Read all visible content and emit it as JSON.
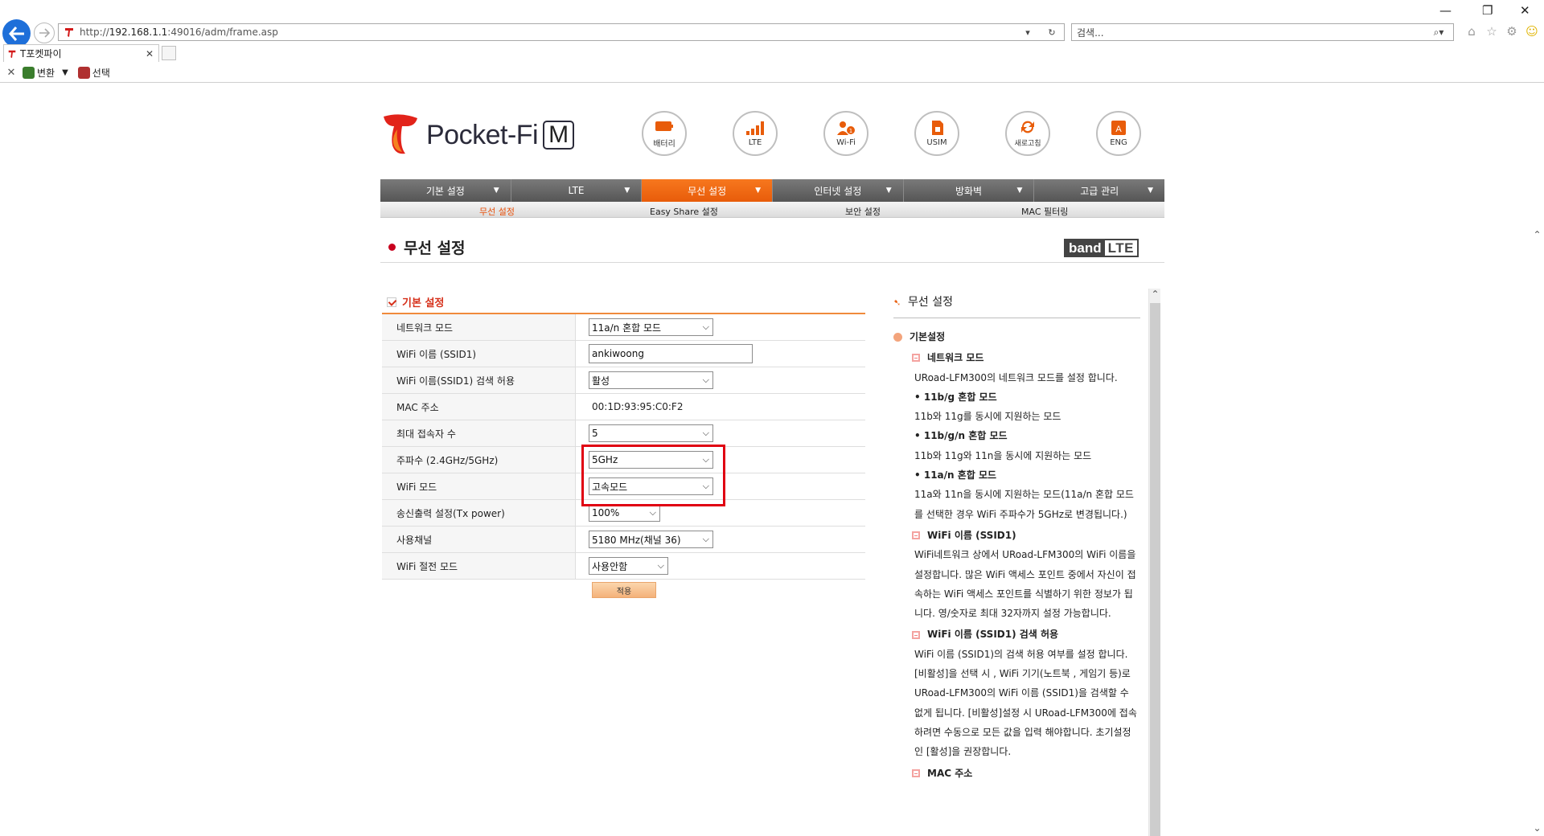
{
  "browser": {
    "url_prefix": "http://",
    "url_host": "192.168.1.1",
    "url_rest": ":49016/adm/frame.asp",
    "search_placeholder": "검색...",
    "tab_title": "T포켓파이",
    "fav_items": [
      "변환",
      "선택"
    ]
  },
  "logo": {
    "text": "Pocket-Fi",
    "badge": "M"
  },
  "top_icons": [
    "배터리",
    "LTE",
    "Wi-Fi",
    "USIM",
    "새로고침",
    "ENG"
  ],
  "main_nav": [
    {
      "label": "기본 설정",
      "active": false
    },
    {
      "label": "LTE",
      "active": false
    },
    {
      "label": "무선 설정",
      "active": true
    },
    {
      "label": "인터넷 설정",
      "active": false
    },
    {
      "label": "방화벽",
      "active": false
    },
    {
      "label": "고급 관리",
      "active": false
    }
  ],
  "sub_nav": [
    {
      "label": "무선 설정",
      "active": true
    },
    {
      "label": "Easy Share 설정",
      "active": false
    },
    {
      "label": "보안 설정",
      "active": false
    },
    {
      "label": "MAC 필터링",
      "active": false
    }
  ],
  "page_title": "무선 설정",
  "band_logo": {
    "left": "band",
    "right": "LTE"
  },
  "form": {
    "section_title": "기본 설정",
    "rows": [
      {
        "label": "네트워크 모드",
        "type": "select",
        "value": "11a/n 혼합 모드"
      },
      {
        "label": "WiFi 이름 (SSID1)",
        "type": "text",
        "value": "ankiwoong"
      },
      {
        "label": "WiFi 이름(SSID1) 검색 허용",
        "type": "select",
        "value": "활성"
      },
      {
        "label": "MAC 주소",
        "type": "static",
        "value": "00:1D:93:95:C0:F2"
      },
      {
        "label": "최대 접속자 수",
        "type": "select",
        "value": "5"
      },
      {
        "label": "주파수 (2.4GHz/5GHz)",
        "type": "select",
        "value": "5GHz"
      },
      {
        "label": "WiFi 모드",
        "type": "select",
        "value": "고속모드"
      },
      {
        "label": "송신출력 설정(Tx power)",
        "type": "select",
        "value": "100%"
      },
      {
        "label": "사용채널",
        "type": "select",
        "value": "5180 MHz(채널 36)"
      },
      {
        "label": "WiFi 절전 모드",
        "type": "select",
        "value": "사용안함"
      }
    ],
    "apply_label": "적용"
  },
  "help": {
    "title": "무선 설정",
    "section": "기본설정",
    "sub1": "네트워크 모드",
    "p1": "URoad-LFM300의 네트워크 모드를 설정 합니다.",
    "b1": "• 11b/g 혼합 모드",
    "p2": "11b와 11g를 동시에 지원하는 모드",
    "b2": "• 11b/g/n 혼합 모드",
    "p3": "11b와 11g와 11n을 동시에 지원하는 모드",
    "b3": "• 11a/n 혼합 모드",
    "p4": "11a와 11n을 동시에 지원하는 모드(11a/n 혼합 모드를 선택한 경우 WiFi 주파수가 5GHz로 변경됩니다.)",
    "sub2": "WiFi 이름 (SSID1)",
    "p5": "WiFi네트워크 상에서 URoad-LFM300의 WiFi 이름을 설정합니다. 많은 WiFi 액세스 포인트 중에서 자신이 접속하는 WiFi 액세스 포인트를 식별하기 위한 정보가 됩니다. 영/숫자로 최대 32자까지 설정 가능합니다.",
    "sub3": "WiFi 이름 (SSID1) 검색 허용",
    "p6": "WiFi 이름 (SSID1)의 검색 허용 여부를 설정 합니다. [비활성]을 선택 시 , WiFi 기기(노트북 , 게임기 등)로 URoad-LFM300의 WiFi 이름 (SSID1)을 검색할 수 없게 됩니다. [비활성]설정 시 URoad-LFM300에 접속 하려면 수동으로 모든 값을 입력 해야합니다. 초기설정인 [활성]을 권장합니다.",
    "sub4": "MAC 주소"
  },
  "colors": {
    "accent": "#e85c0a",
    "highlight": "#e00012",
    "brand_red": "#c8001e"
  }
}
